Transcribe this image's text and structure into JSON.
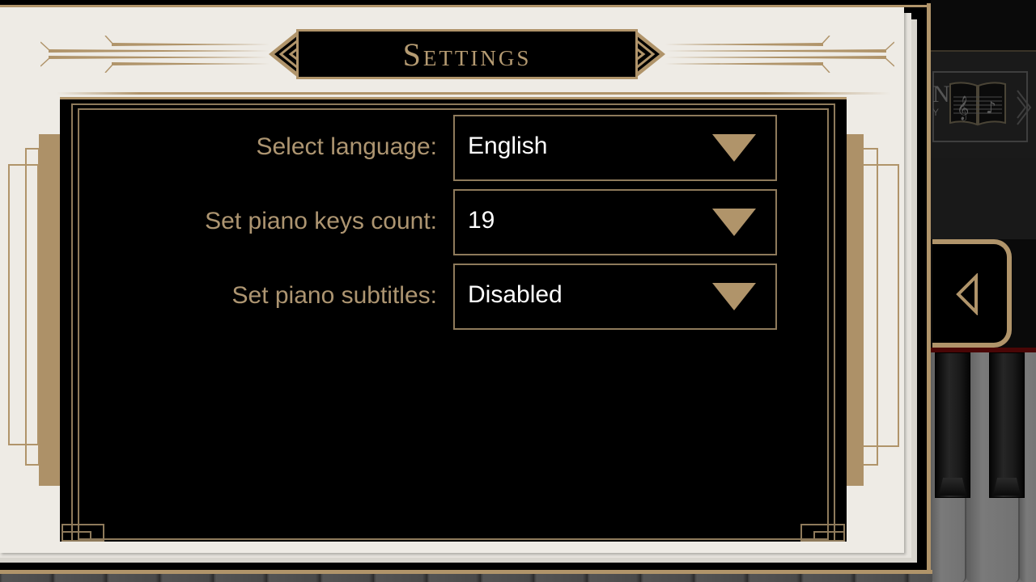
{
  "dialog": {
    "title": "Settings"
  },
  "settings": [
    {
      "label": "Select language:",
      "value": "English",
      "icon": "chevron-down-icon"
    },
    {
      "label": "Set piano keys count:",
      "value": "19",
      "icon": "chevron-down-icon"
    },
    {
      "label": "Set piano subtitles:",
      "value": "Disabled",
      "icon": "chevron-down-icon"
    }
  ],
  "background_app": {
    "logo_partial_letter": "N",
    "logo_partial_sub": "Y",
    "logo_icon": "music-book-icon",
    "collapse_icon": "triangle-left-icon"
  },
  "colors": {
    "gold": "#b0946a",
    "label_gold": "#ad9571",
    "paper": "#eeebe5",
    "panel_bg": "#000000",
    "value_text": "#ffffff"
  }
}
